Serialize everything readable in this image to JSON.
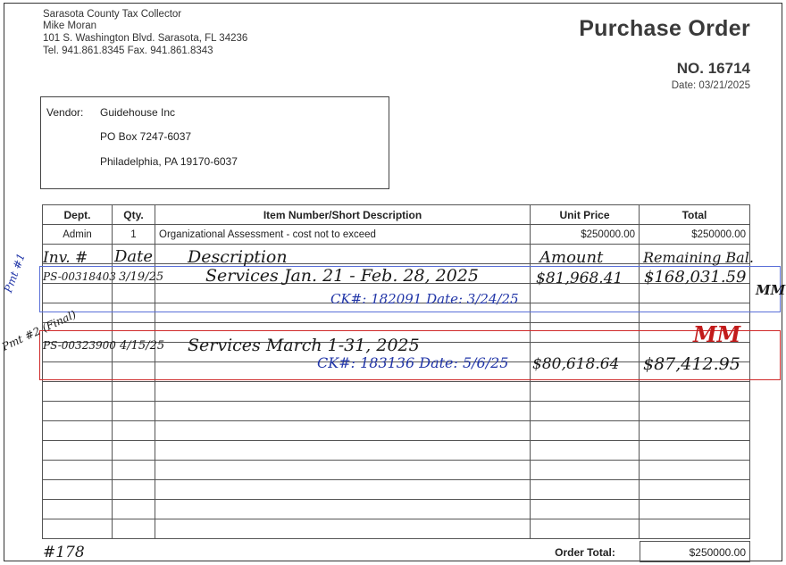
{
  "issuer": {
    "name": "Sarasota County Tax Collector",
    "person": "Mike Moran",
    "address": "101 S. Washington Blvd. Sarasota, FL 34236",
    "phone": "Tel. 941.861.8345 Fax. 941.861.8343"
  },
  "title": "Purchase Order",
  "po_number": "NO. 16714",
  "po_date": "Date: 03/21/2025",
  "vendor": {
    "label": "Vendor:",
    "name": "Guidehouse Inc",
    "line1": "PO Box 7247-6037",
    "line2": "Philadelphia, PA 19170-6037"
  },
  "table": {
    "headers": [
      "Dept.",
      "Qty.",
      "Item Number/Short Description",
      "Unit Price",
      "Total"
    ],
    "row1": {
      "dept": "Admin",
      "qty": "1",
      "desc": "Organizational Assessment - cost not to exceed",
      "unit": "$250000.00",
      "total": "$250000.00"
    }
  },
  "order_total_label": "Order Total:",
  "order_total_value": "$250000.00",
  "handwriting": {
    "hdr_inv": "Inv. #",
    "hdr_date": "Date",
    "hdr_desc": "Description",
    "hdr_amount": "Amount",
    "hdr_remaining": "Remaining Bal.",
    "pmt1_label": "Pmt #1",
    "pmt1_inv": "PS-00318403",
    "pmt1_date": "3/19/25",
    "pmt1_desc": "Services Jan. 21 - Feb. 28, 2025",
    "pmt1_amount": "$81,968.41",
    "pmt1_remaining": "$168,031.59",
    "pmt1_ck": "CK#: 182091 Date: 3/24/25",
    "pmt2_label": "Pmt #2 (Final)",
    "pmt2_inv": "PS-00323900",
    "pmt2_date": "4/15/25",
    "pmt2_desc": "Services March 1-31, 2025",
    "pmt2_ck": "CK#: 183136 Date: 5/6/25",
    "pmt2_amount": "$80,618.64",
    "pmt2_remaining": "$87,412.95",
    "initials": "MM",
    "footer_note": "#178"
  }
}
